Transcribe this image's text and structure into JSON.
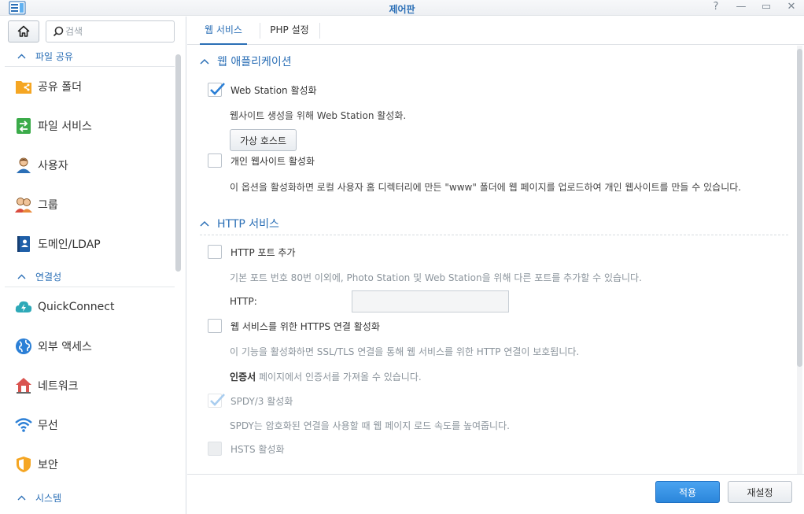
{
  "window": {
    "title": "제어판",
    "buttons": {
      "help": "?",
      "minimize": "—",
      "maximize": "▭",
      "close": "✕"
    }
  },
  "sidebar": {
    "search_placeholder": "검색",
    "sections": [
      {
        "label": "파일 공유",
        "items": [
          {
            "label": "공유 폴더",
            "icon": "shared-folder-icon"
          },
          {
            "label": "파일 서비스",
            "icon": "file-services-icon"
          },
          {
            "label": "사용자",
            "icon": "user-icon"
          },
          {
            "label": "그룹",
            "icon": "group-icon"
          },
          {
            "label": "도메인/LDAP",
            "icon": "domain-ldap-icon"
          }
        ]
      },
      {
        "label": "연결성",
        "items": [
          {
            "label": "QuickConnect",
            "icon": "quickconnect-icon"
          },
          {
            "label": "외부 액세스",
            "icon": "external-access-icon"
          },
          {
            "label": "네트워크",
            "icon": "network-icon"
          },
          {
            "label": "무선",
            "icon": "wireless-icon"
          },
          {
            "label": "보안",
            "icon": "security-icon"
          }
        ]
      },
      {
        "label": "시스템",
        "items": []
      }
    ]
  },
  "tabs": [
    {
      "label": "웹 서비스",
      "active": true
    },
    {
      "label": "PHP 설정",
      "active": false
    }
  ],
  "content": {
    "web_apps": {
      "heading": "웹 애플리케이션",
      "enable_web_station": {
        "label": "Web Station 활성화",
        "checked": true
      },
      "web_station_desc": "웹사이트 생성을 위해 Web Station 활성화.",
      "virtual_host_button": "가상 호스트",
      "personal_site": {
        "label": "개인 웹사이트 활성화",
        "checked": false
      },
      "personal_site_desc": "이 옵션을 활성화하면 로컬 사용자 홈 디렉터리에 만든 \"www\" 폴더에 웹 페이지를 업로드하여 개인 웹사이트를 만들 수 있습니다."
    },
    "http_service": {
      "heading": "HTTP 서비스",
      "add_http_port": {
        "label": "HTTP 포트 추가",
        "checked": false
      },
      "add_http_port_desc": "기본 포트 번호 80번 이외에, Photo Station 및 Web Station을 위해 다른 포트를 추가할 수 있습니다.",
      "http_label": "HTTP:",
      "http_value": "",
      "https": {
        "label": "웹 서비스를 위한 HTTPS 연결 활성화",
        "checked": false
      },
      "https_desc": "이 기능을 활성화하면 SSL/TLS 연결을 통해 웹 서비스를 위한 HTTP 연결이 보호됩니다.",
      "cert_bold": "인증서",
      "cert_desc": " 페이지에서 인증서를 가져올 수 있습니다.",
      "spdy": {
        "label": "SPDY/3 활성화",
        "checked": true,
        "disabled": true
      },
      "spdy_desc": "SPDY는 암호화된 연결을 사용할 때 웹 페이지 로드 속도를 높여줍니다.",
      "hsts": {
        "label": "HSTS 활성화",
        "checked": false,
        "disabled": true
      }
    }
  },
  "footer": {
    "apply": "적용",
    "reset": "재설정"
  },
  "colors": {
    "accent": "#2b6fb6",
    "primary_button": "#2b86db",
    "check": "#2b7fd6"
  }
}
